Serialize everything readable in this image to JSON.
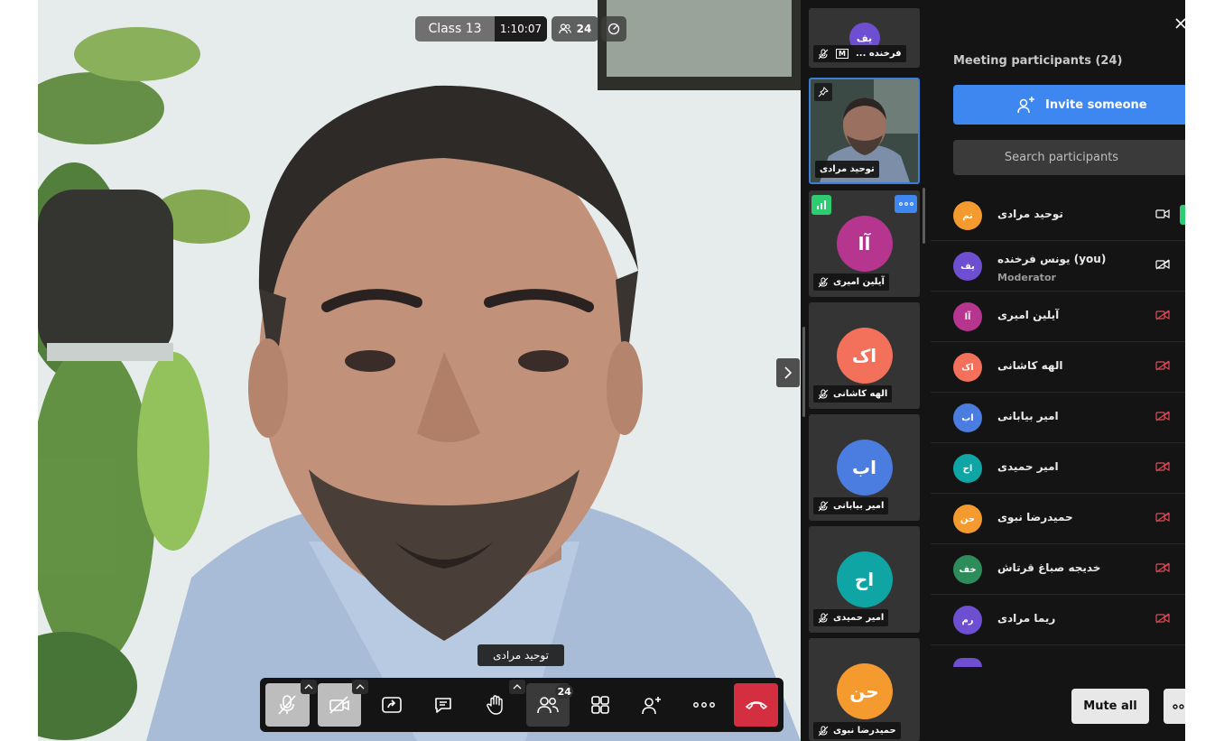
{
  "meeting": {
    "title": "Class 13",
    "duration": "1:10:07",
    "participant_count": "24"
  },
  "stage": {
    "speaker_name": "توحید مرادی"
  },
  "toolbar": {
    "participants_badge": "24"
  },
  "filmstrip": {
    "tiles": [
      {
        "initials": "یف",
        "name": "... فرخنده",
        "color": "#6e4fd1",
        "badge": "M"
      },
      {
        "initials": "",
        "name": "توحید مرادی"
      },
      {
        "initials": "آا",
        "name": "آیلین امیری",
        "color": "#b5358f"
      },
      {
        "initials": "اک",
        "name": "الهه کاشانی",
        "color": "#f3705a"
      },
      {
        "initials": "اب",
        "name": "امیر بیابانی",
        "color": "#4a7ddf"
      },
      {
        "initials": "اح",
        "name": "امیر حمیدی",
        "color": "#0fa5a5"
      },
      {
        "initials": "حن",
        "name": "حمیدرضا نبوی",
        "color": "#f49a2e"
      }
    ]
  },
  "panel": {
    "title": "Meeting participants (24)",
    "invite_label": "Invite someone",
    "search_placeholder": "Search participants",
    "mute_all_label": "Mute all",
    "participants": [
      {
        "initials": "تم",
        "name": "توحید مرادی",
        "color": "#f49a2e",
        "camera": "on"
      },
      {
        "initials": "یف",
        "name": "یونس فرخنده (you)",
        "role": "Moderator",
        "color": "#6e4fd1",
        "camera": "off-white"
      },
      {
        "initials": "آا",
        "name": "آیلین امیری",
        "color": "#b5358f",
        "camera": "off-red"
      },
      {
        "initials": "اک",
        "name": "الهه کاشانی",
        "color": "#f3705a",
        "camera": "off-red"
      },
      {
        "initials": "اب",
        "name": "امیر بیابانی",
        "color": "#4a7ddf",
        "camera": "off-red"
      },
      {
        "initials": "اح",
        "name": "امیر حمیدی",
        "color": "#0fa5a5",
        "camera": "off-red"
      },
      {
        "initials": "حن",
        "name": "حمیدرضا نبوی",
        "color": "#f49a2e",
        "camera": "off-red"
      },
      {
        "initials": "خف",
        "name": "خدیجه صباغ قرتاش",
        "color": "#2e8b5a",
        "camera": "off-red"
      },
      {
        "initials": "رم",
        "name": "ریما مرادی",
        "color": "#6e4fd1",
        "camera": "off-red"
      }
    ]
  }
}
